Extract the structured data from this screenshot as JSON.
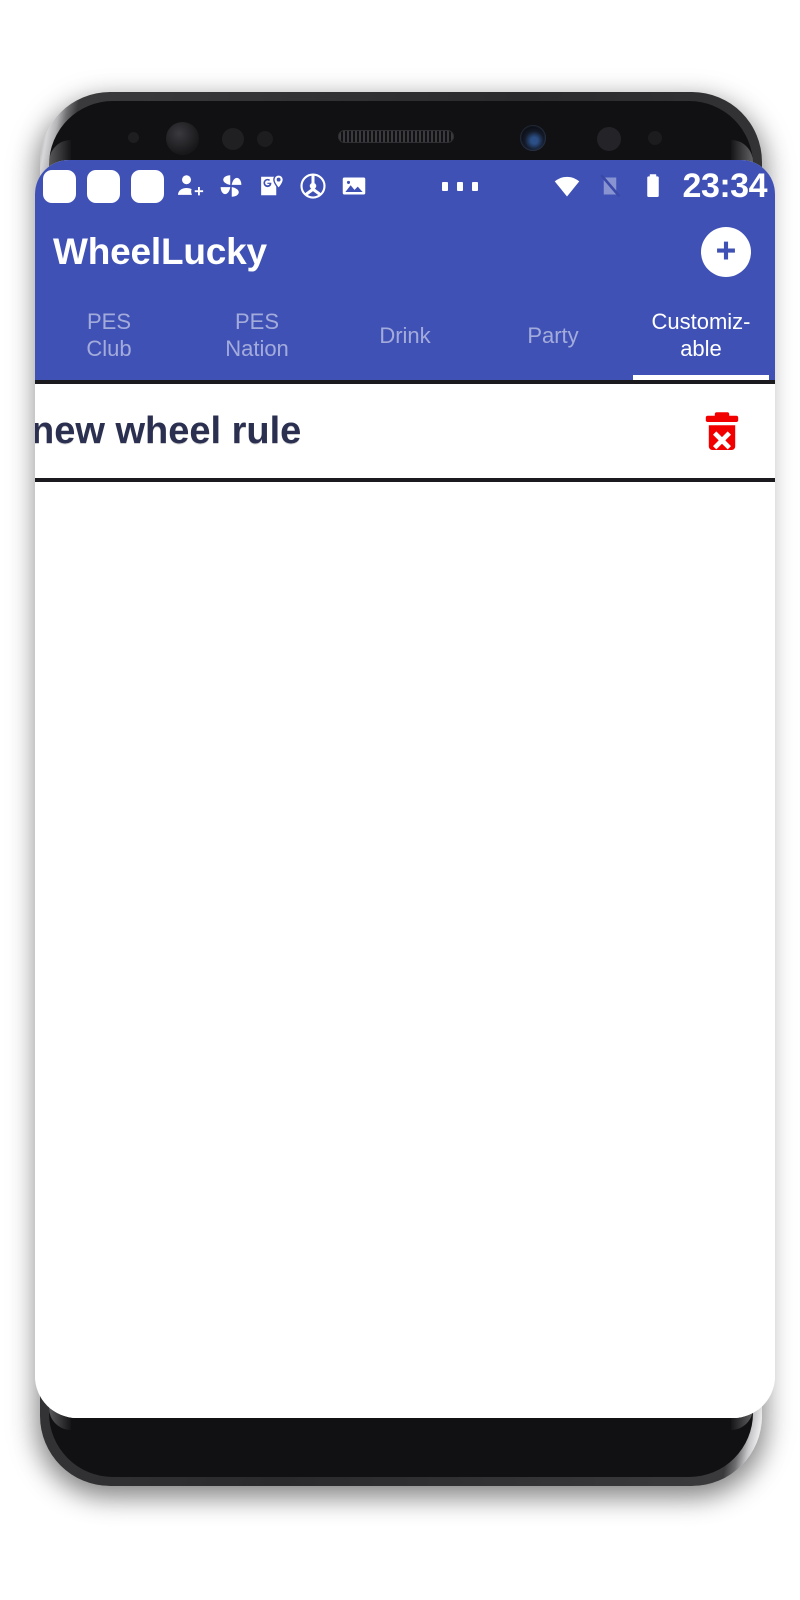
{
  "device": {
    "name": "smartphone-mockup",
    "top_sensors": [
      "proximity-sensor",
      "iris-scanner",
      "light-sensor",
      "led-indicator",
      "earpiece-speaker",
      "front-camera"
    ],
    "side_buttons": [
      "bixby-button",
      "volume-button",
      "power-button"
    ]
  },
  "statusbar": {
    "notification_icons": [
      "notification-placeholder-icon",
      "notification-placeholder-icon",
      "notification-placeholder-icon",
      "person-add-icon",
      "pinwheel-photos-icon",
      "maps-location-icon",
      "steering-wheel-icon",
      "gallery-image-icon"
    ],
    "overflow_indicator": "more-notifications-dots",
    "right_icons": [
      "wifi-icon",
      "no-sim-signal-icon",
      "battery-icon"
    ],
    "time": "23:34",
    "background_color": "#3F51B5",
    "foreground_color": "#FFFFFF"
  },
  "appbar": {
    "title": "WheelLucky",
    "add_button_label": "+",
    "add_button_name": "add-wheel-button",
    "background_color": "#3F51B5",
    "title_color": "#FFFFFF",
    "fab_background": "#FFFFFF",
    "fab_glyph_color": "#3F51B5"
  },
  "tabs": {
    "active_index": 4,
    "indicator_color": "#FFFFFF",
    "inactive_color": "rgba(255,255,255,0.52)",
    "items": [
      {
        "label": "PES\nClub",
        "line1": "PES",
        "line2": "Club",
        "id": "tab-pes-club"
      },
      {
        "label": "PES\nNation",
        "line1": "PES",
        "line2": "Nation",
        "id": "tab-pes-nation"
      },
      {
        "label": "Drink",
        "line1": "Drink",
        "line2": "",
        "id": "tab-drink"
      },
      {
        "label": "Party",
        "line1": "Party",
        "line2": "",
        "id": "tab-party"
      },
      {
        "label": "Customiz-\nable",
        "line1": "Customiz-",
        "line2": "able",
        "id": "tab-customizable"
      }
    ]
  },
  "content": {
    "background_color": "#FFFFFF",
    "divider_color": "#1B1B1F",
    "rows": [
      {
        "label": "new wheel rule",
        "label_color": "#2B3050",
        "delete_icon": "trash-delete-icon",
        "delete_icon_color": "#F20000"
      }
    ]
  }
}
